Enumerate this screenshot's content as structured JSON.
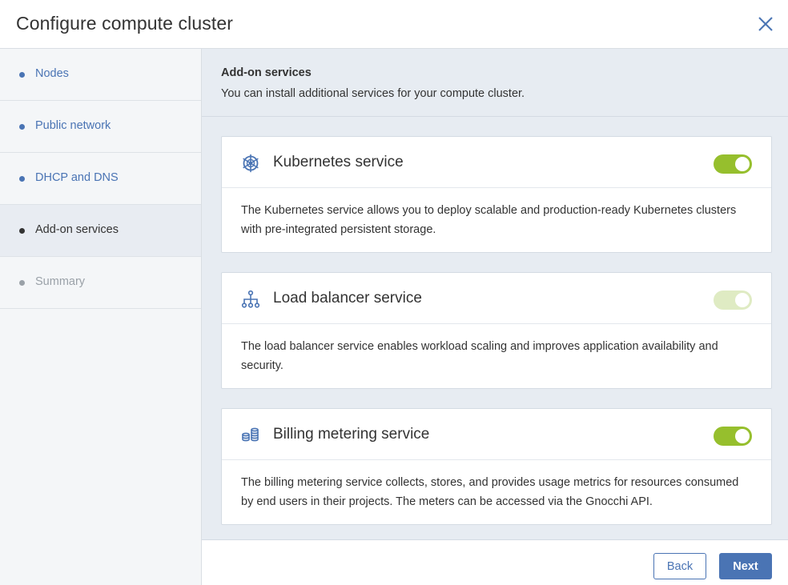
{
  "dialog": {
    "title": "Configure compute cluster"
  },
  "steps": [
    {
      "label": "Nodes",
      "state": "done"
    },
    {
      "label": "Public network",
      "state": "done"
    },
    {
      "label": "DHCP and DNS",
      "state": "done"
    },
    {
      "label": "Add-on services",
      "state": "active"
    },
    {
      "label": "Summary",
      "state": "disabled"
    }
  ],
  "main": {
    "title": "Add-on services",
    "description": "You can install additional services for your compute cluster."
  },
  "services": [
    {
      "name": "Kubernetes service",
      "icon": "kubernetes-icon",
      "enabled": true,
      "toggle_disabled": false,
      "description": "The Kubernetes service allows you to deploy scalable and production-ready Kubernetes clusters with pre-integrated persistent storage."
    },
    {
      "name": "Load balancer service",
      "icon": "network-tree-icon",
      "enabled": true,
      "toggle_disabled": true,
      "description": "The load balancer service enables workload scaling and improves application availability and security."
    },
    {
      "name": "Billing metering service",
      "icon": "coins-stack-icon",
      "enabled": true,
      "toggle_disabled": false,
      "description": "The billing metering service collects, stores, and provides usage metrics for resources consumed by end users in their projects. The meters can be accessed via the Gnocchi API."
    }
  ],
  "footer": {
    "back_label": "Back",
    "next_label": "Next"
  },
  "colors": {
    "accent": "#4a74b4",
    "toggle_on": "#96bf2d",
    "toggle_disabled": "#dfebc3",
    "panel_bg": "#e7ecf2"
  }
}
